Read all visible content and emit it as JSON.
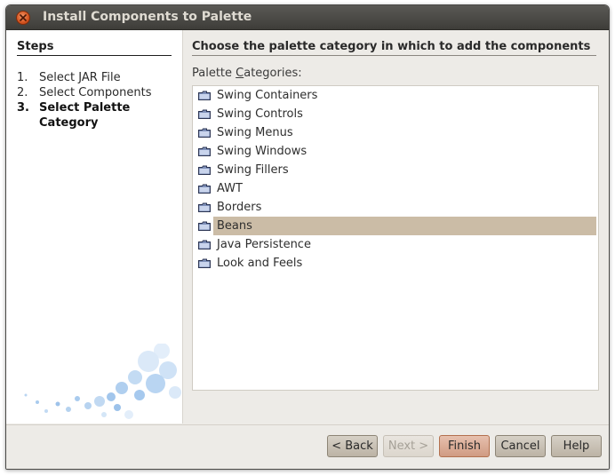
{
  "window": {
    "title": "Install Components to Palette"
  },
  "sidebar": {
    "heading": "Steps",
    "steps": [
      {
        "num": "1.",
        "label": "Select JAR File",
        "current": false
      },
      {
        "num": "2.",
        "label": "Select Components",
        "current": false
      },
      {
        "num": "3.",
        "label": "Select Palette Category",
        "current": true
      }
    ]
  },
  "main": {
    "title": "Choose the palette category in which to add the components",
    "list_label": "Palette Categories:",
    "categories": [
      "Swing Containers",
      "Swing Controls",
      "Swing Menus",
      "Swing Windows",
      "Swing Fillers",
      "AWT",
      "Borders",
      "Beans",
      "Java Persistence",
      "Look and Feels"
    ],
    "selected_category": "Beans"
  },
  "buttons": {
    "back": "< Back",
    "next": "Next >",
    "finish": "Finish",
    "cancel": "Cancel",
    "help": "Help"
  },
  "colors": {
    "selection": "#cbbca6",
    "titlebar": "#3e3d39",
    "close_button": "#d4531f"
  },
  "icons": {
    "window_close": "close-icon",
    "category": "folder-icon"
  }
}
